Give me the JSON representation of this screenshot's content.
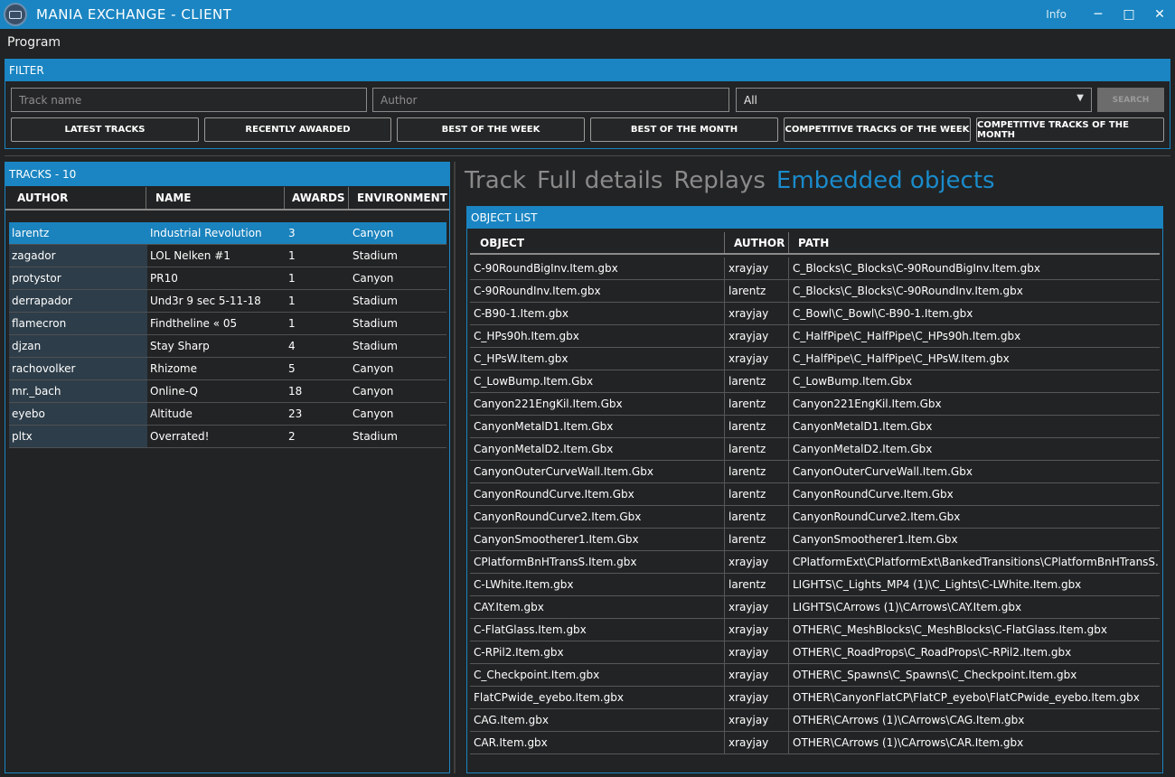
{
  "window": {
    "title": "MANIA EXCHANGE - CLIENT",
    "info_label": "Info",
    "minimize": "─",
    "maximize": "□",
    "close": "✕"
  },
  "menu": {
    "program": "Program"
  },
  "filter": {
    "header": "FILTER",
    "track_name_placeholder": "Track name",
    "author_placeholder": "Author",
    "environment_selected": "All",
    "search_label": "SEARCH",
    "buttons": [
      "LATEST TRACKS",
      "RECENTLY AWARDED",
      "BEST OF THE WEEK",
      "BEST OF THE MONTH",
      "COMPETITIVE TRACKS OF THE WEEK",
      "COMPETITIVE TRACKS OF THE MONTH"
    ]
  },
  "tracks": {
    "header": "TRACKS - 10",
    "columns": [
      "AUTHOR",
      "NAME",
      "AWARDS",
      "ENVIRONMENT"
    ],
    "selected_index": 0,
    "rows": [
      [
        "larentz",
        "Industrial Revolution",
        "3",
        "Canyon"
      ],
      [
        "zagador",
        "LOL Nelken #1",
        "1",
        "Stadium"
      ],
      [
        "protystor",
        "PR10",
        "1",
        "Canyon"
      ],
      [
        "derrapador",
        "Und3r 9 sec 5-11-18",
        "1",
        "Stadium"
      ],
      [
        "flamecron",
        "Findtheline « 05",
        "1",
        "Stadium"
      ],
      [
        "djzan",
        "Stay Sharp",
        "4",
        "Stadium"
      ],
      [
        "rachovolker",
        "Rhizome",
        "5",
        "Canyon"
      ],
      [
        "mr._bach",
        "Online-Q",
        "18",
        "Canyon"
      ],
      [
        "eyebo",
        "Altitude",
        "23",
        "Canyon"
      ],
      [
        "pltx",
        "Overrated!",
        "2",
        "Stadium"
      ]
    ]
  },
  "details": {
    "tabs": [
      "Track",
      "Full details",
      "Replays",
      "Embedded objects"
    ],
    "active_tab": 3,
    "object_list": {
      "header": "OBJECT LIST",
      "columns": [
        "OBJECT",
        "AUTHOR",
        "PATH"
      ],
      "rows": [
        [
          "C-90RoundBigInv.Item.gbx",
          "xrayjay",
          "C_Blocks\\C_Blocks\\C-90RoundBigInv.Item.gbx"
        ],
        [
          "C-90RoundInv.Item.gbx",
          "larentz",
          "C_Blocks\\C_Blocks\\C-90RoundInv.Item.gbx"
        ],
        [
          "C-B90-1.Item.gbx",
          "xrayjay",
          "C_Bowl\\C_Bowl\\C-B90-1.Item.gbx"
        ],
        [
          "C_HPs90h.Item.gbx",
          "xrayjay",
          "C_HalfPipe\\C_HalfPipe\\C_HPs90h.Item.gbx"
        ],
        [
          "C_HPsW.Item.gbx",
          "xrayjay",
          "C_HalfPipe\\C_HalfPipe\\C_HPsW.Item.gbx"
        ],
        [
          "C_LowBump.Item.Gbx",
          "larentz",
          "C_LowBump.Item.Gbx"
        ],
        [
          "Canyon221EngKil.Item.Gbx",
          "larentz",
          "Canyon221EngKil.Item.Gbx"
        ],
        [
          "CanyonMetalD1.Item.Gbx",
          "larentz",
          "CanyonMetalD1.Item.Gbx"
        ],
        [
          "CanyonMetalD2.Item.Gbx",
          "larentz",
          "CanyonMetalD2.Item.Gbx"
        ],
        [
          "CanyonOuterCurveWall.Item.Gbx",
          "larentz",
          "CanyonOuterCurveWall.Item.Gbx"
        ],
        [
          "CanyonRoundCurve.Item.Gbx",
          "larentz",
          "CanyonRoundCurve.Item.Gbx"
        ],
        [
          "CanyonRoundCurve2.Item.Gbx",
          "larentz",
          "CanyonRoundCurve2.Item.Gbx"
        ],
        [
          "CanyonSmootherer1.Item.Gbx",
          "larentz",
          "CanyonSmootherer1.Item.Gbx"
        ],
        [
          "CPlatformBnHTransS.Item.gbx",
          "xrayjay",
          "CPlatformExt\\CPlatformExt\\BankedTransitions\\CPlatformBnHTransS.Item.gbx"
        ],
        [
          "C-LWhite.Item.gbx",
          "larentz",
          "LIGHTS\\C_Lights_MP4 (1)\\C_Lights\\C-LWhite.Item.gbx"
        ],
        [
          "CAY.Item.gbx",
          "xrayjay",
          "LIGHTS\\CArrows (1)\\CArrows\\CAY.Item.gbx"
        ],
        [
          "C-FlatGlass.Item.gbx",
          "xrayjay",
          "OTHER\\C_MeshBlocks\\C_MeshBlocks\\C-FlatGlass.Item.gbx"
        ],
        [
          "C-RPil2.Item.gbx",
          "xrayjay",
          "OTHER\\C_RoadProps\\C_RoadProps\\C-RPil2.Item.gbx"
        ],
        [
          "C_Checkpoint.Item.gbx",
          "xrayjay",
          "OTHER\\C_Spawns\\C_Spawns\\C_Checkpoint.Item.gbx"
        ],
        [
          "FlatCPwide_eyebo.Item.gbx",
          "xrayjay",
          "OTHER\\CanyonFlatCP\\FlatCP_eyebo\\FlatCPwide_eyebo.Item.gbx"
        ],
        [
          "CAG.Item.gbx",
          "xrayjay",
          "OTHER\\CArrows (1)\\CArrows\\CAG.Item.gbx"
        ],
        [
          "CAR.Item.gbx",
          "xrayjay",
          "OTHER\\CArrows (1)\\CArrows\\CAR.Item.gbx"
        ]
      ]
    }
  },
  "colors": {
    "accent": "#1a85c2",
    "background": "#222324",
    "selected_row": "#1a82bd",
    "active_tab": "#1a8bcb",
    "inactive_tab": "#8a8a8a"
  }
}
